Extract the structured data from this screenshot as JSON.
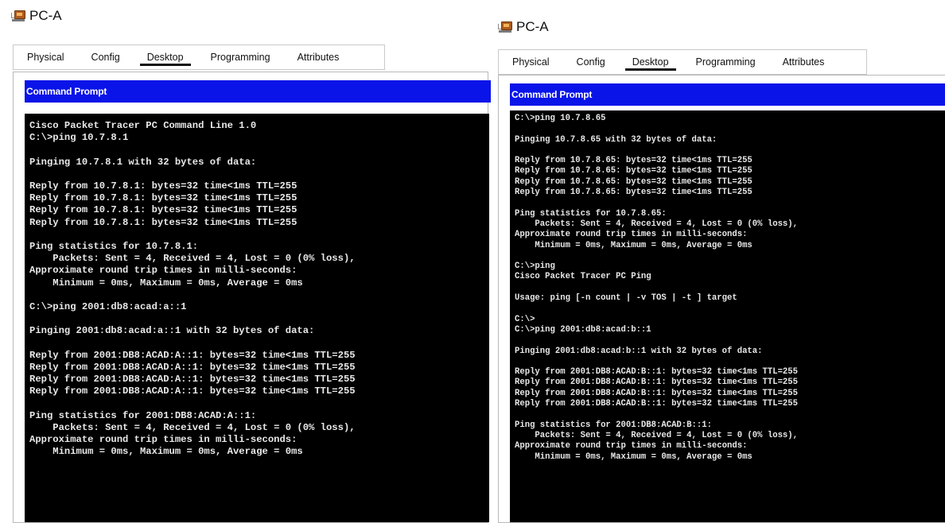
{
  "windows": [
    {
      "title": "PC-A",
      "tabs": [
        "Physical",
        "Config",
        "Desktop",
        "Programming",
        "Attributes"
      ],
      "active_tab": "Desktop",
      "panel_title": "Command Prompt",
      "terminal_lines": [
        "Cisco Packet Tracer PC Command Line 1.0",
        "C:\\>ping 10.7.8.1",
        "",
        "Pinging 10.7.8.1 with 32 bytes of data:",
        "",
        "Reply from 10.7.8.1: bytes=32 time<1ms TTL=255",
        "Reply from 10.7.8.1: bytes=32 time<1ms TTL=255",
        "Reply from 10.7.8.1: bytes=32 time<1ms TTL=255",
        "Reply from 10.7.8.1: bytes=32 time<1ms TTL=255",
        "",
        "Ping statistics for 10.7.8.1:",
        "    Packets: Sent = 4, Received = 4, Lost = 0 (0% loss),",
        "Approximate round trip times in milli-seconds:",
        "    Minimum = 0ms, Maximum = 0ms, Average = 0ms",
        "",
        "C:\\>ping 2001:db8:acad:a::1",
        "",
        "Pinging 2001:db8:acad:a::1 with 32 bytes of data:",
        "",
        "Reply from 2001:DB8:ACAD:A::1: bytes=32 time<1ms TTL=255",
        "Reply from 2001:DB8:ACAD:A::1: bytes=32 time<1ms TTL=255",
        "Reply from 2001:DB8:ACAD:A::1: bytes=32 time<1ms TTL=255",
        "Reply from 2001:DB8:ACAD:A::1: bytes=32 time<1ms TTL=255",
        "",
        "Ping statistics for 2001:DB8:ACAD:A::1:",
        "    Packets: Sent = 4, Received = 4, Lost = 0 (0% loss),",
        "Approximate round trip times in milli-seconds:",
        "    Minimum = 0ms, Maximum = 0ms, Average = 0ms"
      ]
    },
    {
      "title": "PC-A",
      "tabs": [
        "Physical",
        "Config",
        "Desktop",
        "Programming",
        "Attributes"
      ],
      "active_tab": "Desktop",
      "panel_title": "Command Prompt",
      "terminal_lines": [
        "C:\\>ping 10.7.8.65",
        "",
        "Pinging 10.7.8.65 with 32 bytes of data:",
        "",
        "Reply from 10.7.8.65: bytes=32 time<1ms TTL=255",
        "Reply from 10.7.8.65: bytes=32 time<1ms TTL=255",
        "Reply from 10.7.8.65: bytes=32 time<1ms TTL=255",
        "Reply from 10.7.8.65: bytes=32 time<1ms TTL=255",
        "",
        "Ping statistics for 10.7.8.65:",
        "    Packets: Sent = 4, Received = 4, Lost = 0 (0% loss),",
        "Approximate round trip times in milli-seconds:",
        "    Minimum = 0ms, Maximum = 0ms, Average = 0ms",
        "",
        "C:\\>ping",
        "Cisco Packet Tracer PC Ping",
        "",
        "Usage: ping [-n count | -v TOS | -t ] target",
        "",
        "C:\\>",
        "C:\\>ping 2001:db8:acad:b::1",
        "",
        "Pinging 2001:db8:acad:b::1 with 32 bytes of data:",
        "",
        "Reply from 2001:DB8:ACAD:B::1: bytes=32 time<1ms TTL=255",
        "Reply from 2001:DB8:ACAD:B::1: bytes=32 time<1ms TTL=255",
        "Reply from 2001:DB8:ACAD:B::1: bytes=32 time<1ms TTL=255",
        "Reply from 2001:DB8:ACAD:B::1: bytes=32 time<1ms TTL=255",
        "",
        "Ping statistics for 2001:DB8:ACAD:B::1:",
        "    Packets: Sent = 4, Received = 4, Lost = 0 (0% loss),",
        "Approximate round trip times in milli-seconds:",
        "    Minimum = 0ms, Maximum = 0ms, Average = 0ms"
      ]
    }
  ]
}
